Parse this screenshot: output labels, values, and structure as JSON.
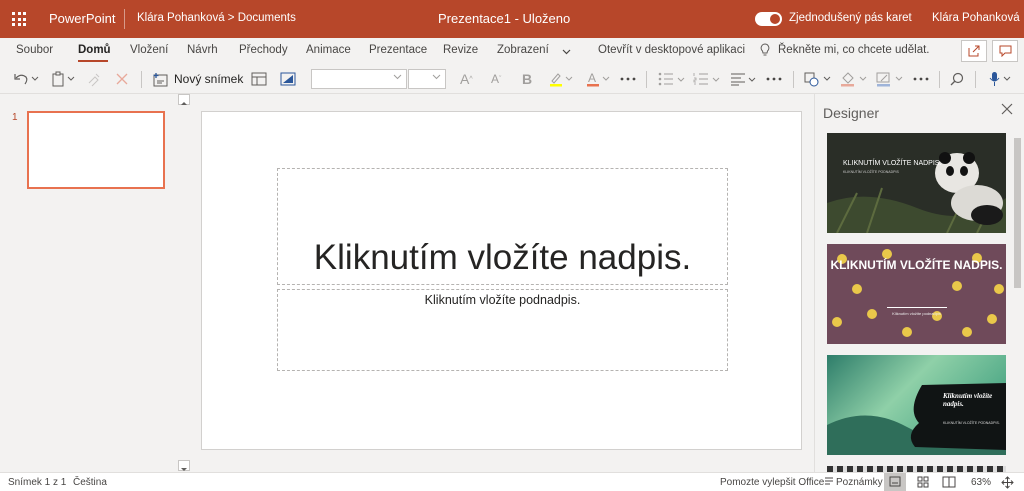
{
  "titlebar": {
    "app_name": "PowerPoint",
    "breadcrumb": "Klára Pohanková  >  Documents",
    "doc_title": "Prezentace1   -   Uloženo",
    "toggle_label": "Zjednodušený pás karet",
    "user": "Klára Pohanková",
    "brand_color": "#b7472a"
  },
  "ribbon": {
    "tabs": [
      {
        "label": "Soubor"
      },
      {
        "label": "Domů",
        "active": true
      },
      {
        "label": "Vložení"
      },
      {
        "label": "Návrh"
      },
      {
        "label": "Přechody"
      },
      {
        "label": "Animace"
      },
      {
        "label": "Prezentace"
      },
      {
        "label": "Revize"
      },
      {
        "label": "Zobrazení"
      }
    ],
    "more_chevron": "chevron-down-icon",
    "open_desktop": "Otevřít v desktopové aplikaci",
    "tell_me": "Řekněte mi, co chcete udělat."
  },
  "toolbar": {
    "new_slide": "Nový snímek",
    "font_name": "",
    "font_size": ""
  },
  "thumbnails": {
    "slide_number": "1"
  },
  "slide": {
    "title_placeholder": "Kliknutím vložíte nadpis.",
    "subtitle_placeholder": "Kliknutím vložíte podnadpis."
  },
  "designer": {
    "title": "Designer",
    "options": [
      {
        "title": "KLIKNUTÍM VLOŽÍTE NADPIS.",
        "subtitle": "KLIKNUTÍM VLOŽÍTE PODNADPIS"
      },
      {
        "title": "KLIKNUTÍM VLOŽÍTE NADPIS.",
        "subtitle": "Kliknutím vložíte podnadpis"
      },
      {
        "title": "Kliknutím vložíte nadpis.",
        "subtitle": "KLIKNUTÍM VLOŽÍTE PODNADPIS."
      }
    ]
  },
  "statusbar": {
    "slide_count": "Snímek 1 z 1",
    "language": "Čeština",
    "feedback": "Pomozte vylepšit Office",
    "notes": "Poznámky",
    "zoom": "63%"
  }
}
